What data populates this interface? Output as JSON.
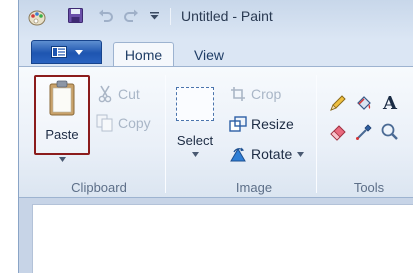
{
  "window": {
    "title": "Untitled - Paint"
  },
  "quick_access": {
    "icons": [
      "paint-app-icon",
      "save-icon",
      "undo-icon",
      "redo-icon",
      "customize-toolbar-icon"
    ]
  },
  "tabs": [
    {
      "label": "Home",
      "selected": true
    },
    {
      "label": "View",
      "selected": false
    }
  ],
  "ribbon": {
    "clipboard": {
      "label": "Clipboard",
      "paste": "Paste",
      "cut": "Cut",
      "copy": "Copy"
    },
    "image": {
      "label": "Image",
      "select": "Select",
      "crop": "Crop",
      "resize": "Resize",
      "rotate": "Rotate"
    },
    "tools": {
      "label": "Tools",
      "text_tool": "A",
      "items": [
        "pencil-icon",
        "fill-icon",
        "text-icon",
        "eraser-icon",
        "color-picker-icon",
        "magnifier-icon"
      ]
    }
  },
  "colors": {
    "highlight_border": "#8b1c1c",
    "paint_button": "#1e55b0",
    "ribbon_bg": "#eaf0f8"
  }
}
